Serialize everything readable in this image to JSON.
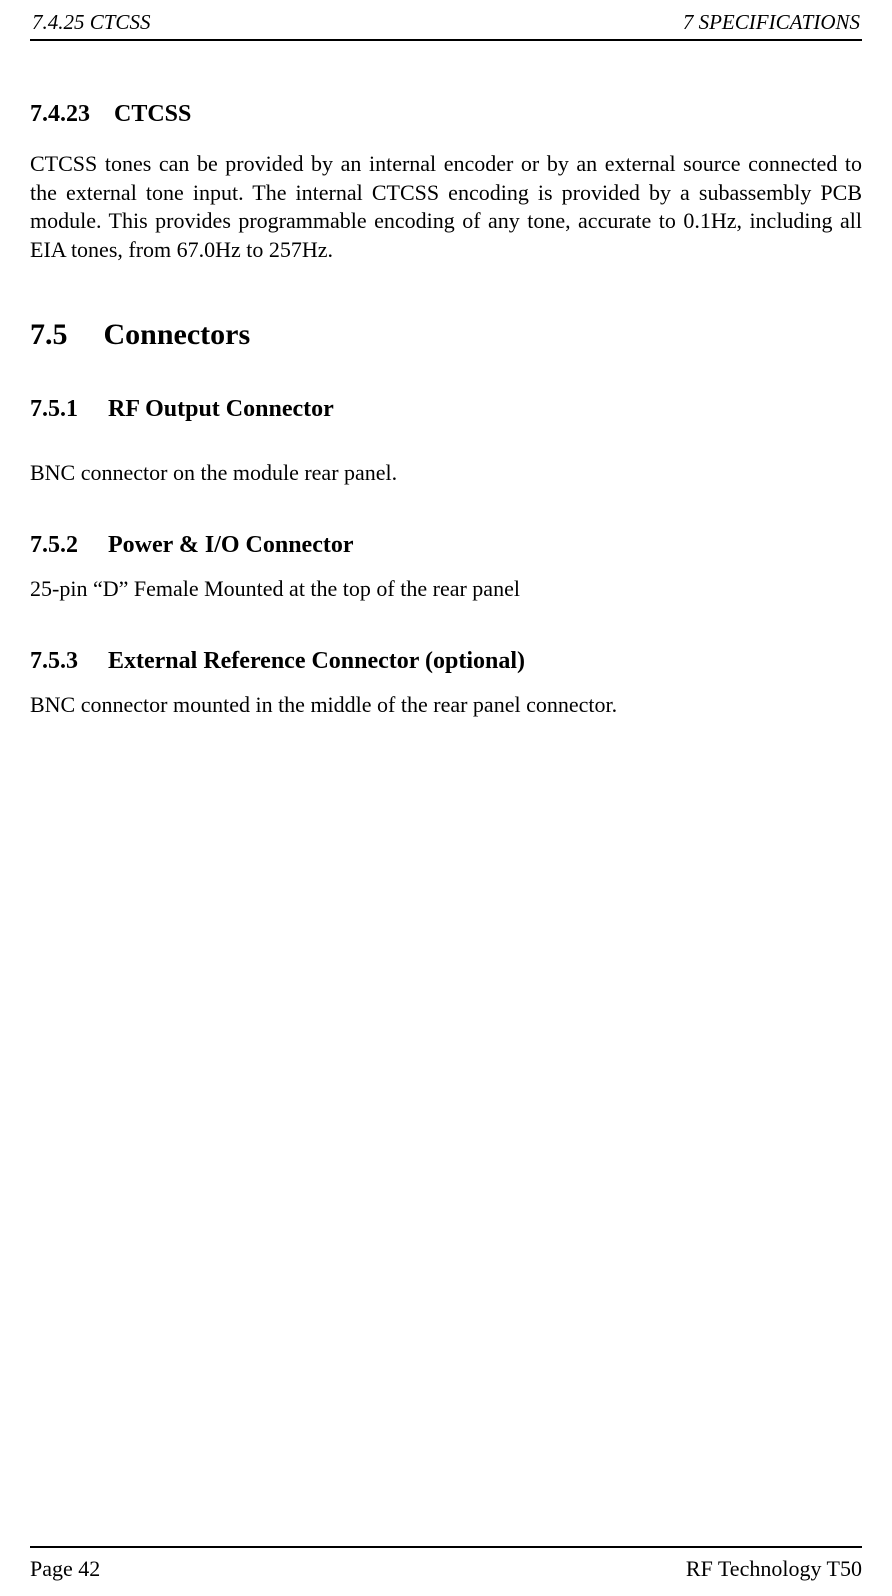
{
  "header": {
    "left": "7.4.25  CTCSS",
    "right": "7  SPECIFICATIONS"
  },
  "s1": {
    "num": "7.4.23",
    "title": "CTCSS",
    "body": "CTCSS tones can be provided by an internal encoder or by an external source connected to the external tone input.  The internal CTCSS encoding is provided by a subassembly PCB module.  This provides programmable encoding of any tone, accurate to 0.1Hz, including all EIA tones, from 67.0Hz to 257Hz."
  },
  "s2": {
    "num": "7.5",
    "title": "Connectors"
  },
  "s3": {
    "num": "7.5.1",
    "title": "RF Output Connector",
    "body": "BNC connector on the module rear panel."
  },
  "s4": {
    "num": "7.5.2",
    "title": "Power & I/O Connector",
    "body": "25-pin “D” Female Mounted at the top of the rear panel"
  },
  "s5": {
    "num": "7.5.3",
    "title": "External Reference Connector (optional)",
    "body": "BNC connector mounted in the middle of the rear panel connector."
  },
  "footer": {
    "left": "Page 42",
    "right": "RF Technology T50"
  }
}
